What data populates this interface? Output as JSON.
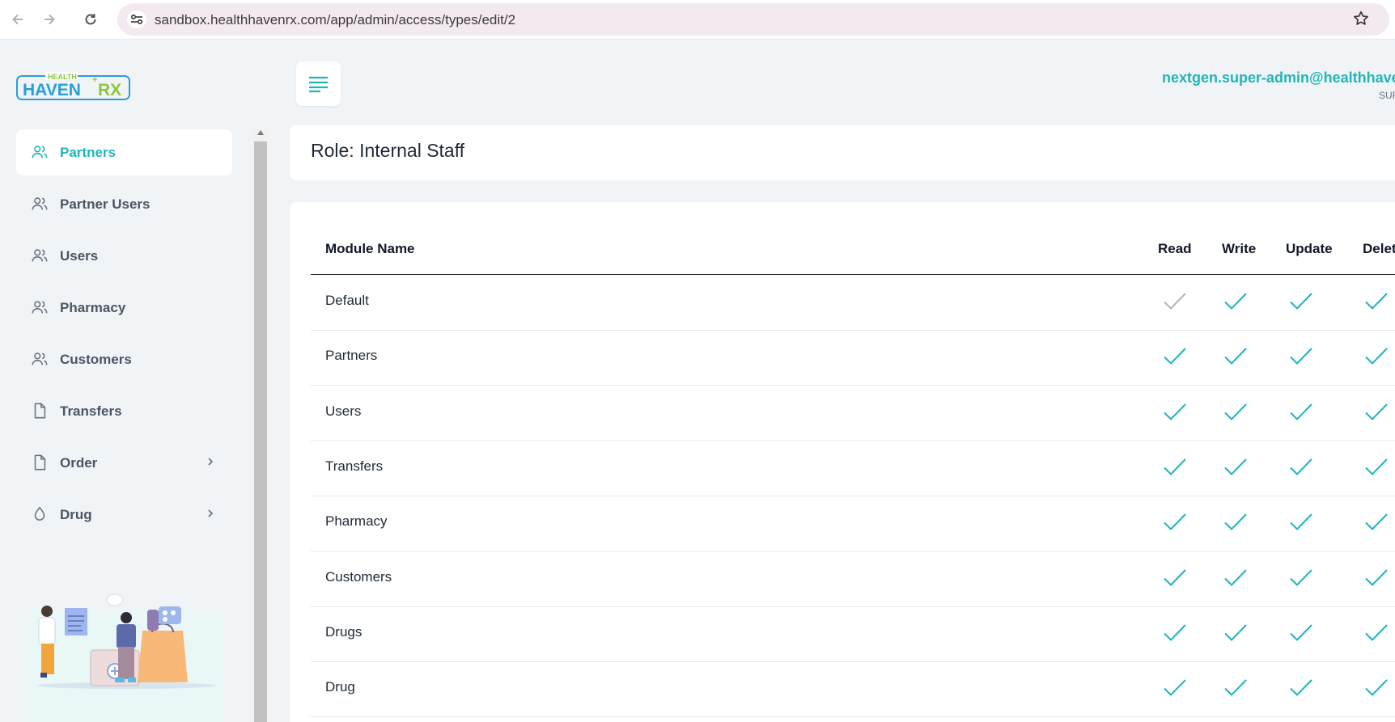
{
  "browser": {
    "url": "sandbox.healthhavenrx.com/app/admin/access/types/edit/2",
    "back_icon": "arrow-left-icon",
    "forward_icon": "arrow-right-icon",
    "reload_icon": "reload-icon",
    "site_info_icon": "tune-icon",
    "bookmark_icon": "star-icon"
  },
  "brand": {
    "logo_small": "HEALTH",
    "logo_main": "HAVEN",
    "logo_rx": "RX",
    "colors": {
      "accent": "#1fb5b9",
      "logo_blue": "#2a9ed6",
      "logo_green": "#8cc63f"
    }
  },
  "sidebar": {
    "items": [
      {
        "label": "Partners",
        "icon": "users-icon",
        "active": true
      },
      {
        "label": "Partner Users",
        "icon": "users-icon"
      },
      {
        "label": "Users",
        "icon": "users-icon"
      },
      {
        "label": "Pharmacy",
        "icon": "users-icon"
      },
      {
        "label": "Customers",
        "icon": "users-icon"
      },
      {
        "label": "Transfers",
        "icon": "file-icon"
      },
      {
        "label": "Order",
        "icon": "file-icon",
        "has_submenu": true
      },
      {
        "label": "Drug",
        "icon": "droplet-icon",
        "has_submenu": true
      }
    ]
  },
  "header": {
    "menu_icon": "align-left-icon",
    "user_email": "nextgen.super-admin@healthhavenrx.com",
    "user_role": "SUPER ADMIN"
  },
  "role": {
    "title": "Role: Internal Staff"
  },
  "table": {
    "columns": [
      "Module Name",
      "Read",
      "Write",
      "Update",
      "Delete"
    ],
    "rows": [
      {
        "name": "Default",
        "read": false,
        "write": true,
        "update": true,
        "delete": true
      },
      {
        "name": "Partners",
        "read": true,
        "write": true,
        "update": true,
        "delete": true
      },
      {
        "name": "Users",
        "read": true,
        "write": true,
        "update": true,
        "delete": true
      },
      {
        "name": "Transfers",
        "read": true,
        "write": true,
        "update": true,
        "delete": true
      },
      {
        "name": "Pharmacy",
        "read": true,
        "write": true,
        "update": true,
        "delete": true
      },
      {
        "name": "Customers",
        "read": true,
        "write": true,
        "update": true,
        "delete": true
      },
      {
        "name": "Drugs",
        "read": true,
        "write": true,
        "update": true,
        "delete": true
      },
      {
        "name": "Drug",
        "read": true,
        "write": true,
        "update": true,
        "delete": true
      }
    ],
    "check_on_color": "#1fb5b9",
    "check_off_color": "#b5b5b5"
  }
}
